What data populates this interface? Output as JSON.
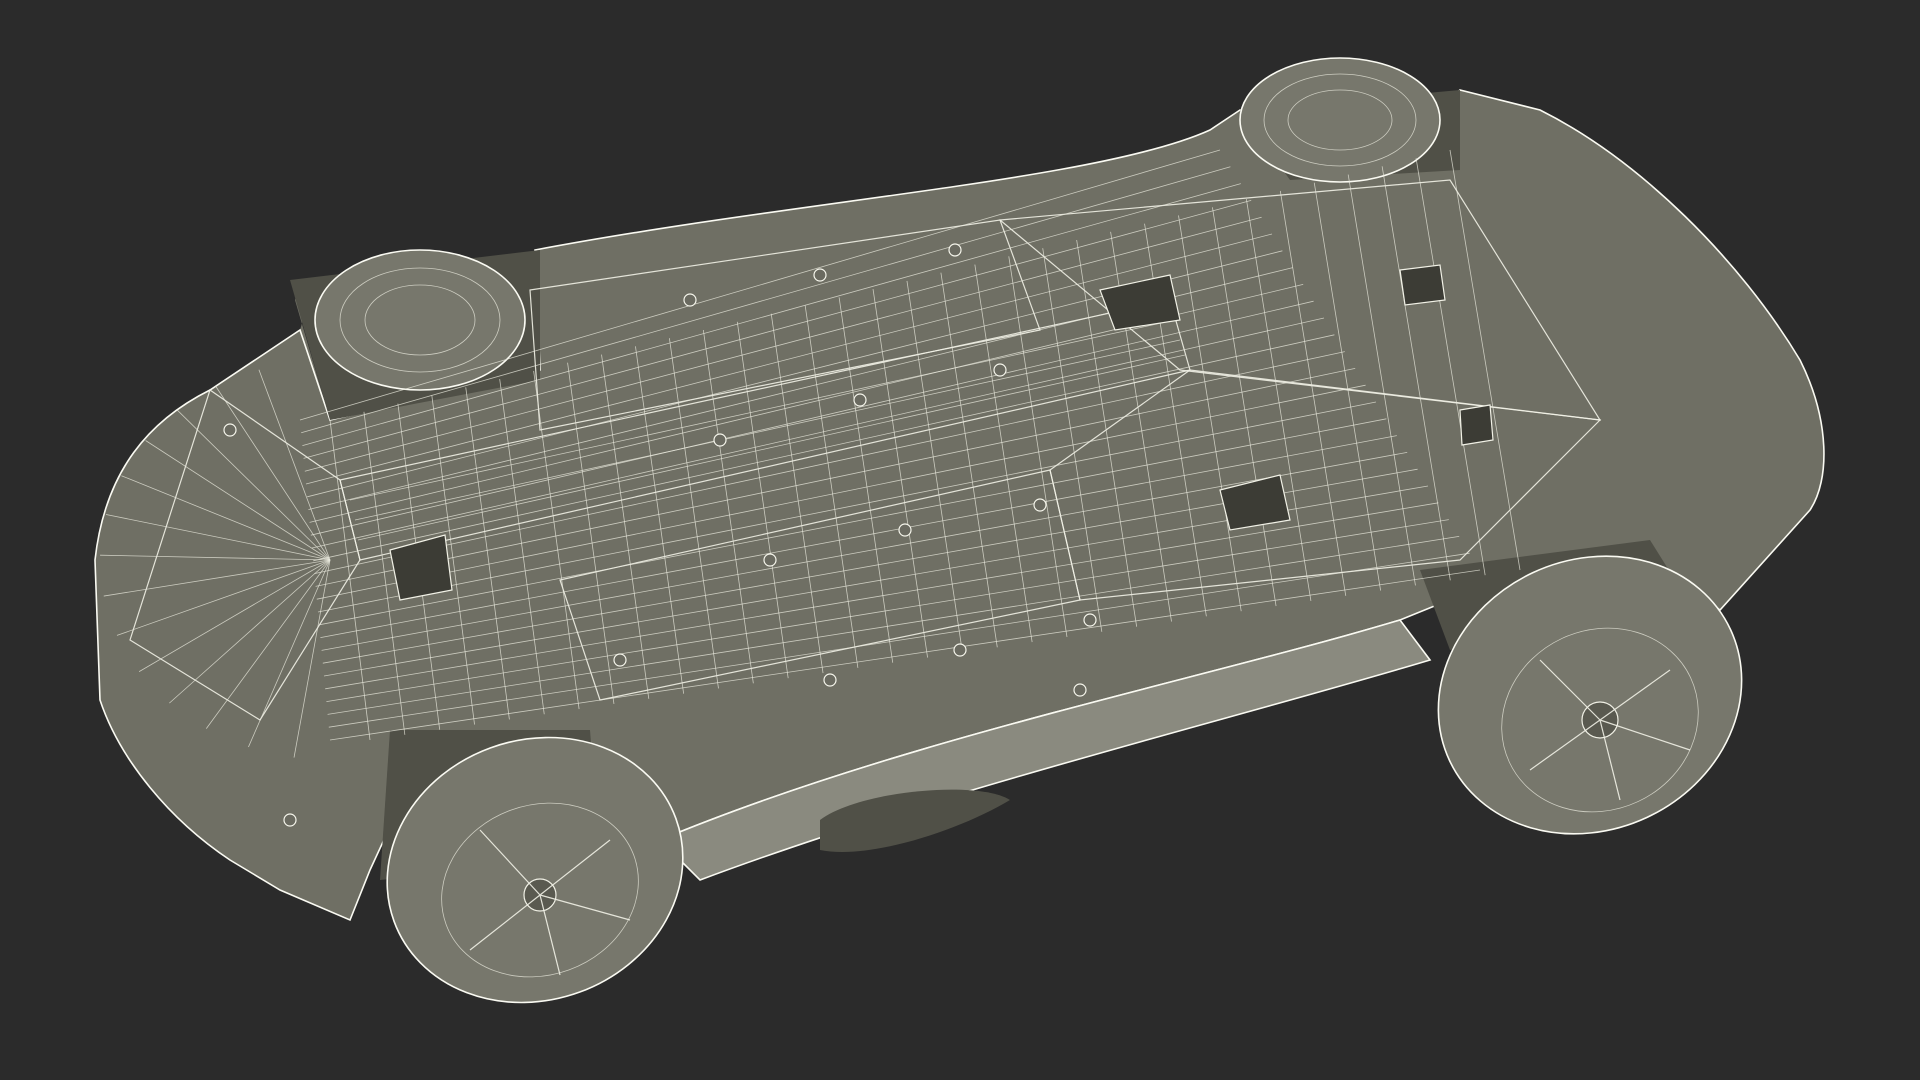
{
  "scene": {
    "subject": "",
    "background_color": "#2b2b2b",
    "mesh_fill_color": "#7a7a6f",
    "wire_color": "#f1f1e6"
  }
}
